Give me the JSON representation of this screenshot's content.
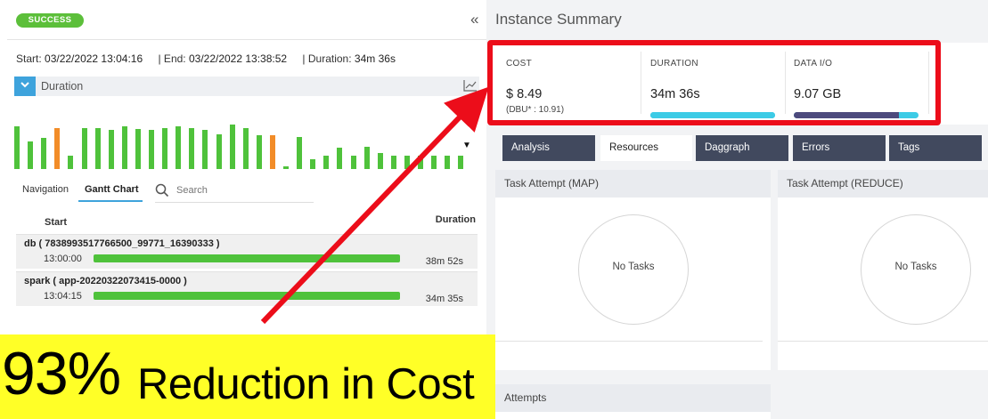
{
  "job": {
    "status": "SUCCESS",
    "collapse_icon": "double-chevron-left-icon",
    "start_label": "Start:",
    "start_value": "03/22/2022 13:04:16",
    "end_label": "| End:",
    "end_value": "03/22/2022 13:38:52",
    "duration_label": "| Duration:",
    "duration_value": "34m 36s"
  },
  "duration_section": {
    "label": "Duration",
    "toggle_icon": "chevron-down-icon",
    "chart_icon": "line-chart-icon",
    "bars": [
      {
        "value": 0.95,
        "color": "#4fc23b"
      },
      {
        "value": 0.62,
        "color": "#4fc23b"
      },
      {
        "value": 0.7,
        "color": "#4fc23b"
      },
      {
        "value": 0.92,
        "color": "#f28c28"
      },
      {
        "value": 0.3,
        "color": "#4fc23b"
      },
      {
        "value": 0.92,
        "color": "#4fc23b"
      },
      {
        "value": 0.92,
        "color": "#4fc23b"
      },
      {
        "value": 0.88,
        "color": "#4fc23b"
      },
      {
        "value": 0.95,
        "color": "#4fc23b"
      },
      {
        "value": 0.9,
        "color": "#4fc23b"
      },
      {
        "value": 0.88,
        "color": "#4fc23b"
      },
      {
        "value": 0.92,
        "color": "#4fc23b"
      },
      {
        "value": 0.95,
        "color": "#4fc23b"
      },
      {
        "value": 0.92,
        "color": "#4fc23b"
      },
      {
        "value": 0.88,
        "color": "#4fc23b"
      },
      {
        "value": 0.78,
        "color": "#4fc23b"
      },
      {
        "value": 1.0,
        "color": "#4fc23b"
      },
      {
        "value": 0.92,
        "color": "#4fc23b"
      },
      {
        "value": 0.75,
        "color": "#4fc23b"
      },
      {
        "value": 0.75,
        "color": "#f28c28"
      },
      {
        "value": 0.05,
        "color": "#4fc23b"
      },
      {
        "value": 0.72,
        "color": "#4fc23b"
      },
      {
        "value": 0.22,
        "color": "#4fc23b"
      },
      {
        "value": 0.3,
        "color": "#4fc23b"
      },
      {
        "value": 0.48,
        "color": "#4fc23b"
      },
      {
        "value": 0.3,
        "color": "#4fc23b"
      },
      {
        "value": 0.5,
        "color": "#4fc23b"
      },
      {
        "value": 0.35,
        "color": "#4fc23b"
      },
      {
        "value": 0.3,
        "color": "#4fc23b"
      },
      {
        "value": 0.3,
        "color": "#4fc23b"
      },
      {
        "value": 0.3,
        "color": "#4fc23b"
      },
      {
        "value": 0.3,
        "color": "#4fc23b"
      },
      {
        "value": 0.3,
        "color": "#4fc23b"
      },
      {
        "value": 0.3,
        "color": "#4fc23b"
      }
    ],
    "caret": "▼"
  },
  "left_tabs": {
    "navigation": "Navigation",
    "gantt": "Gantt Chart",
    "search_placeholder": "Search",
    "search_icon": "search-icon"
  },
  "gantt": {
    "col_start": "Start",
    "col_duration": "Duration",
    "rows": [
      {
        "name": "db ( 7838993517766500_99771_16390333 )",
        "time": "13:00:00",
        "duration": "38m 52s"
      },
      {
        "name": "spark ( app-20220322073415-0000 )",
        "time": "13:04:15",
        "duration": "34m 35s"
      }
    ]
  },
  "banner": {
    "percent": "93%",
    "text": "Reduction in Cost"
  },
  "instance": {
    "title": "Instance Summary",
    "metrics": [
      {
        "label": "COST",
        "value": "$ 8.49",
        "sub": "(DBU* : 10.91)"
      },
      {
        "label": "DURATION",
        "value": "34m 36s"
      },
      {
        "label": "DATA I/O",
        "value": "9.07 GB"
      }
    ],
    "duration_progress": 1.0,
    "dataio_progress": 0.84,
    "highlight_color": "#ec0d1a"
  },
  "right_tabs": [
    "Analysis",
    "Resources",
    "Daggraph",
    "Errors",
    "Tags"
  ],
  "panes": {
    "map_title": "Task Attempt (MAP)",
    "reduce_title": "Task Attempt (REDUCE)",
    "empty_text": "No Tasks",
    "attempts_title": "Attempts"
  }
}
